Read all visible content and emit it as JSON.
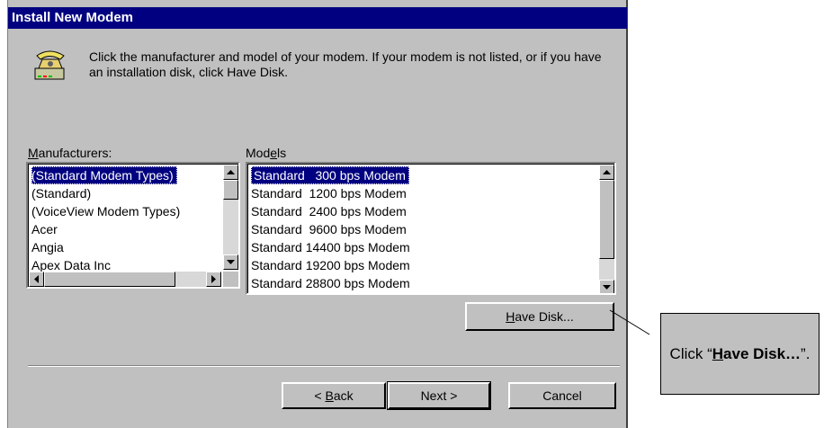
{
  "window": {
    "title": "Install New Modem"
  },
  "instructions": "Click the manufacturer and model of your modem. If your modem is not listed, or if you have an installation disk, click Have Disk.",
  "manufacturers": {
    "label_prefix": "",
    "label_u": "M",
    "label_rest": "anufacturers:",
    "items": [
      "(Standard Modem Types)",
      "(Standard)",
      "(VoiceView Modem Types)",
      "Acer",
      "Angia",
      "Apex Data Inc"
    ],
    "selected_index": 0
  },
  "models": {
    "label_prefix": "Mod",
    "label_u": "e",
    "label_rest": "ls",
    "items": [
      "Standard   300 bps Modem",
      "Standard  1200 bps Modem",
      "Standard  2400 bps Modem",
      "Standard  9600 bps Modem",
      "Standard 14400 bps Modem",
      "Standard 19200 bps Modem",
      "Standard 28800 bps Modem"
    ],
    "selected_index": 0
  },
  "buttons": {
    "have_disk": {
      "u": "H",
      "rest": "ave Disk..."
    },
    "back": {
      "prefix": "< ",
      "u": "B",
      "rest": "ack"
    },
    "next": "Next >",
    "cancel": "Cancel"
  },
  "callout": {
    "prefix": "Click “",
    "u": "H",
    "bold_rest": "ave Disk…",
    "suffix": "”."
  },
  "icons": [
    "modem-phone-icon",
    "scroll-up-arrow-icon",
    "scroll-down-arrow-icon",
    "scroll-left-arrow-icon",
    "scroll-right-arrow-icon"
  ]
}
